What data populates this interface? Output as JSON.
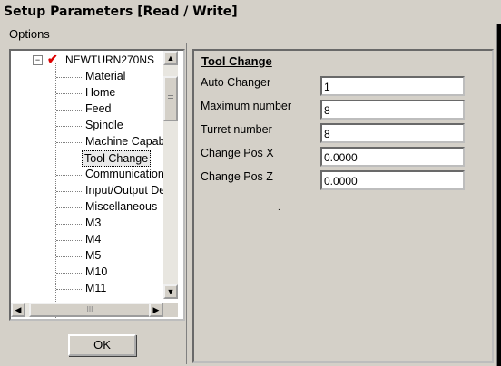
{
  "window": {
    "title": "Setup Parameters [Read / Write]"
  },
  "menu": {
    "options_label": "Options"
  },
  "tree": {
    "root": "NEWTURN270NS",
    "items": [
      {
        "label": "Material"
      },
      {
        "label": "Home"
      },
      {
        "label": "Feed"
      },
      {
        "label": "Spindle"
      },
      {
        "label": "Machine Capab"
      },
      {
        "label": "Tool Change",
        "selected": true
      },
      {
        "label": "Communication"
      },
      {
        "label": "Input/Output De"
      },
      {
        "label": "Miscellaneous"
      },
      {
        "label": "M3"
      },
      {
        "label": "M4"
      },
      {
        "label": "M5"
      },
      {
        "label": "M10"
      },
      {
        "label": "M11"
      }
    ]
  },
  "buttons": {
    "ok_label": "OK"
  },
  "section": {
    "title": "Tool Change",
    "fields": [
      {
        "label": "Auto Changer",
        "value": "1"
      },
      {
        "label": "Maximum number",
        "value": "8"
      },
      {
        "label": "Turret number",
        "value": "8"
      },
      {
        "label": "Change Pos X",
        "value": "0.0000"
      },
      {
        "label": "Change Pos Z",
        "value": "0.0000"
      }
    ]
  },
  "scrollbar": {
    "up_arrow": "▲",
    "down_arrow": "▼",
    "left_arrow": "◀",
    "right_arrow": "▶",
    "grip": "III"
  }
}
